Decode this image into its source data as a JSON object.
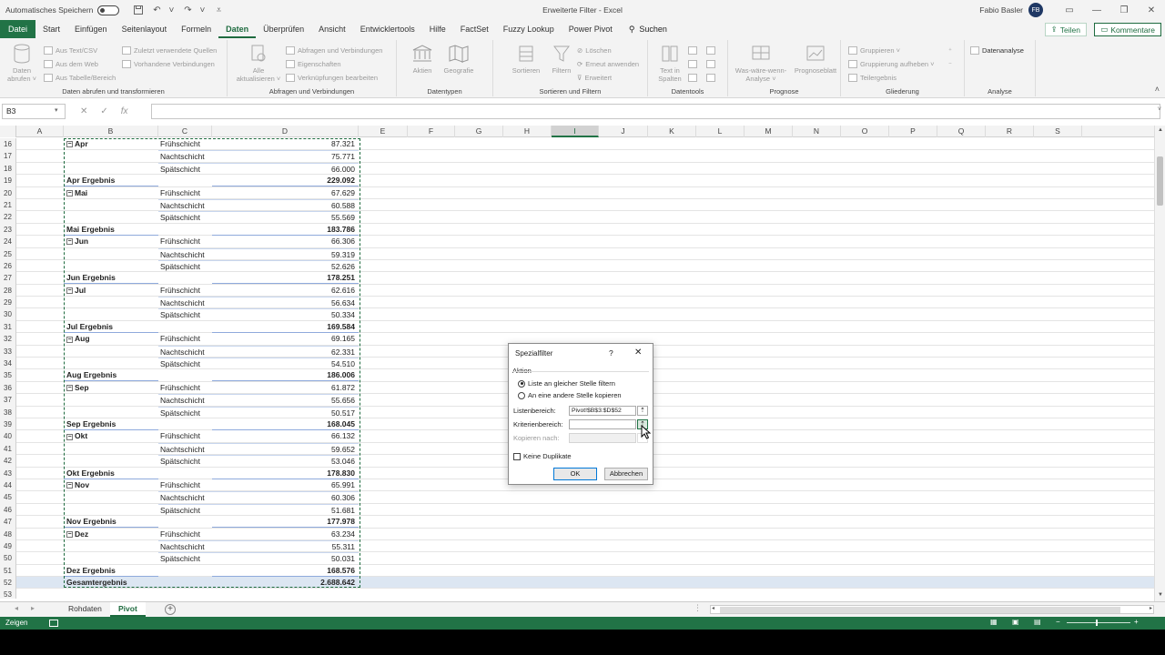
{
  "titlebar": {
    "autosave_label": "Automatisches Speichern",
    "title": "Erweiterte Filter  -  Excel",
    "user_name": "Fabio Basler",
    "avatar_initials": "FB"
  },
  "menu": {
    "tabs": [
      "Datei",
      "Start",
      "Einfügen",
      "Seitenlayout",
      "Formeln",
      "Daten",
      "Überprüfen",
      "Ansicht",
      "Entwicklertools",
      "Hilfe",
      "FactSet",
      "Fuzzy Lookup",
      "Power Pivot"
    ],
    "active": "Daten",
    "search_label": "Suchen",
    "share_label": "Teilen",
    "comments_label": "Kommentare"
  },
  "ribbon": {
    "group1": {
      "label": "Daten abrufen und transformieren",
      "big": "Daten abrufen ˅",
      "items": [
        "Aus Text/CSV",
        "Aus dem Web",
        "Aus Tabelle/Bereich"
      ],
      "items2": [
        "Zuletzt verwendete Quellen",
        "Vorhandene Verbindungen"
      ]
    },
    "group2": {
      "label": "Abfragen und Verbindungen",
      "big": "Alle aktualisieren ˅",
      "items": [
        "Abfragen und Verbindungen",
        "Eigenschaften",
        "Verknüpfungen bearbeiten"
      ]
    },
    "group3": {
      "label": "Datentypen",
      "items": [
        "Aktien",
        "Geografie"
      ]
    },
    "group4": {
      "label": "Sortieren und Filtern",
      "big1": "Sortieren",
      "big2": "Filtern",
      "items": [
        "Löschen",
        "Erneut anwenden",
        "Erweitert"
      ]
    },
    "group5": {
      "label": "Datentools",
      "big": "Text in Spalten"
    },
    "group6": {
      "label": "Prognose",
      "big1": "Was-wäre-wenn-Analyse ˅",
      "big2": "Prognoseblatt"
    },
    "group7": {
      "label": "Gliederung",
      "items": [
        "Gruppieren  ˅",
        "Gruppierung aufheben  ˅",
        "Teilergebnis"
      ]
    },
    "group8": {
      "label": "Analyse",
      "item": "Datenanalyse"
    }
  },
  "formula_bar": {
    "name_box": "B3",
    "fx": "fx",
    "value": ""
  },
  "columns": [
    "A",
    "B",
    "C",
    "D",
    "E",
    "F",
    "G",
    "H",
    "I",
    "J",
    "K",
    "L",
    "M",
    "N",
    "O",
    "P",
    "Q",
    "R",
    "S"
  ],
  "selected_column": "I",
  "rows": [
    {
      "n": "16",
      "b": "Apr",
      "c": "Frühschicht",
      "d": "87.321",
      "type": "month"
    },
    {
      "n": "17",
      "b": "",
      "c": "Nachtschicht",
      "d": "75.771",
      "type": "shift"
    },
    {
      "n": "18",
      "b": "",
      "c": "Spätschicht",
      "d": "66.000",
      "type": "shift"
    },
    {
      "n": "19",
      "b": "Apr Ergebnis",
      "c": "",
      "d": "229.092",
      "type": "total"
    },
    {
      "n": "20",
      "b": "Mai",
      "c": "Frühschicht",
      "d": "67.629",
      "type": "month"
    },
    {
      "n": "21",
      "b": "",
      "c": "Nachtschicht",
      "d": "60.588",
      "type": "shift"
    },
    {
      "n": "22",
      "b": "",
      "c": "Spätschicht",
      "d": "55.569",
      "type": "shift"
    },
    {
      "n": "23",
      "b": "Mai Ergebnis",
      "c": "",
      "d": "183.786",
      "type": "total"
    },
    {
      "n": "24",
      "b": "Jun",
      "c": "Frühschicht",
      "d": "66.306",
      "type": "month"
    },
    {
      "n": "25",
      "b": "",
      "c": "Nachtschicht",
      "d": "59.319",
      "type": "shift"
    },
    {
      "n": "26",
      "b": "",
      "c": "Spätschicht",
      "d": "52.626",
      "type": "shift"
    },
    {
      "n": "27",
      "b": "Jun Ergebnis",
      "c": "",
      "d": "178.251",
      "type": "total"
    },
    {
      "n": "28",
      "b": "Jul",
      "c": "Frühschicht",
      "d": "62.616",
      "type": "month"
    },
    {
      "n": "29",
      "b": "",
      "c": "Nachtschicht",
      "d": "56.634",
      "type": "shift"
    },
    {
      "n": "30",
      "b": "",
      "c": "Spätschicht",
      "d": "50.334",
      "type": "shift"
    },
    {
      "n": "31",
      "b": "Jul Ergebnis",
      "c": "",
      "d": "169.584",
      "type": "total"
    },
    {
      "n": "32",
      "b": "Aug",
      "c": "Frühschicht",
      "d": "69.165",
      "type": "month"
    },
    {
      "n": "33",
      "b": "",
      "c": "Nachtschicht",
      "d": "62.331",
      "type": "shift"
    },
    {
      "n": "34",
      "b": "",
      "c": "Spätschicht",
      "d": "54.510",
      "type": "shift"
    },
    {
      "n": "35",
      "b": "Aug Ergebnis",
      "c": "",
      "d": "186.006",
      "type": "total"
    },
    {
      "n": "36",
      "b": "Sep",
      "c": "Frühschicht",
      "d": "61.872",
      "type": "month"
    },
    {
      "n": "37",
      "b": "",
      "c": "Nachtschicht",
      "d": "55.656",
      "type": "shift"
    },
    {
      "n": "38",
      "b": "",
      "c": "Spätschicht",
      "d": "50.517",
      "type": "shift"
    },
    {
      "n": "39",
      "b": "Sep Ergebnis",
      "c": "",
      "d": "168.045",
      "type": "total"
    },
    {
      "n": "40",
      "b": "Okt",
      "c": "Frühschicht",
      "d": "66.132",
      "type": "month"
    },
    {
      "n": "41",
      "b": "",
      "c": "Nachtschicht",
      "d": "59.652",
      "type": "shift"
    },
    {
      "n": "42",
      "b": "",
      "c": "Spätschicht",
      "d": "53.046",
      "type": "shift"
    },
    {
      "n": "43",
      "b": "Okt Ergebnis",
      "c": "",
      "d": "178.830",
      "type": "total"
    },
    {
      "n": "44",
      "b": "Nov",
      "c": "Frühschicht",
      "d": "65.991",
      "type": "month"
    },
    {
      "n": "45",
      "b": "",
      "c": "Nachtschicht",
      "d": "60.306",
      "type": "shift"
    },
    {
      "n": "46",
      "b": "",
      "c": "Spätschicht",
      "d": "51.681",
      "type": "shift"
    },
    {
      "n": "47",
      "b": "Nov Ergebnis",
      "c": "",
      "d": "177.978",
      "type": "total"
    },
    {
      "n": "48",
      "b": "Dez",
      "c": "Frühschicht",
      "d": "63.234",
      "type": "month"
    },
    {
      "n": "49",
      "b": "",
      "c": "Nachtschicht",
      "d": "55.311",
      "type": "shift"
    },
    {
      "n": "50",
      "b": "",
      "c": "Spätschicht",
      "d": "50.031",
      "type": "shift"
    },
    {
      "n": "51",
      "b": "Dez Ergebnis",
      "c": "",
      "d": "168.576",
      "type": "total"
    },
    {
      "n": "52",
      "b": "Gesamtergebnis",
      "c": "",
      "d": "2.688.642",
      "type": "grand"
    },
    {
      "n": "53",
      "b": "",
      "c": "",
      "d": "",
      "type": "empty"
    }
  ],
  "sheets": {
    "tabs": [
      "Rohdaten",
      "Pivot"
    ],
    "active": "Pivot"
  },
  "status": {
    "mode": "Zeigen"
  },
  "dialog": {
    "title": "Spezialfilter",
    "help": "?",
    "close": "✕",
    "section": "Aktion",
    "radio1": "Liste an gleicher Stelle filtern",
    "radio2": "An eine andere Stelle kopieren",
    "list_label": "Listenbereich:",
    "list_value": "Pivot!$B$3:$D$52",
    "criteria_label": "Kriterienbereich:",
    "criteria_value": "",
    "copy_label": "Kopieren nach:",
    "copy_value": "",
    "unique_label": "Keine Duplikate",
    "ok": "OK",
    "cancel": "Abbrechen"
  },
  "colors": {
    "excel_green": "#217346",
    "grand_total_fill": "#dce6f2"
  }
}
